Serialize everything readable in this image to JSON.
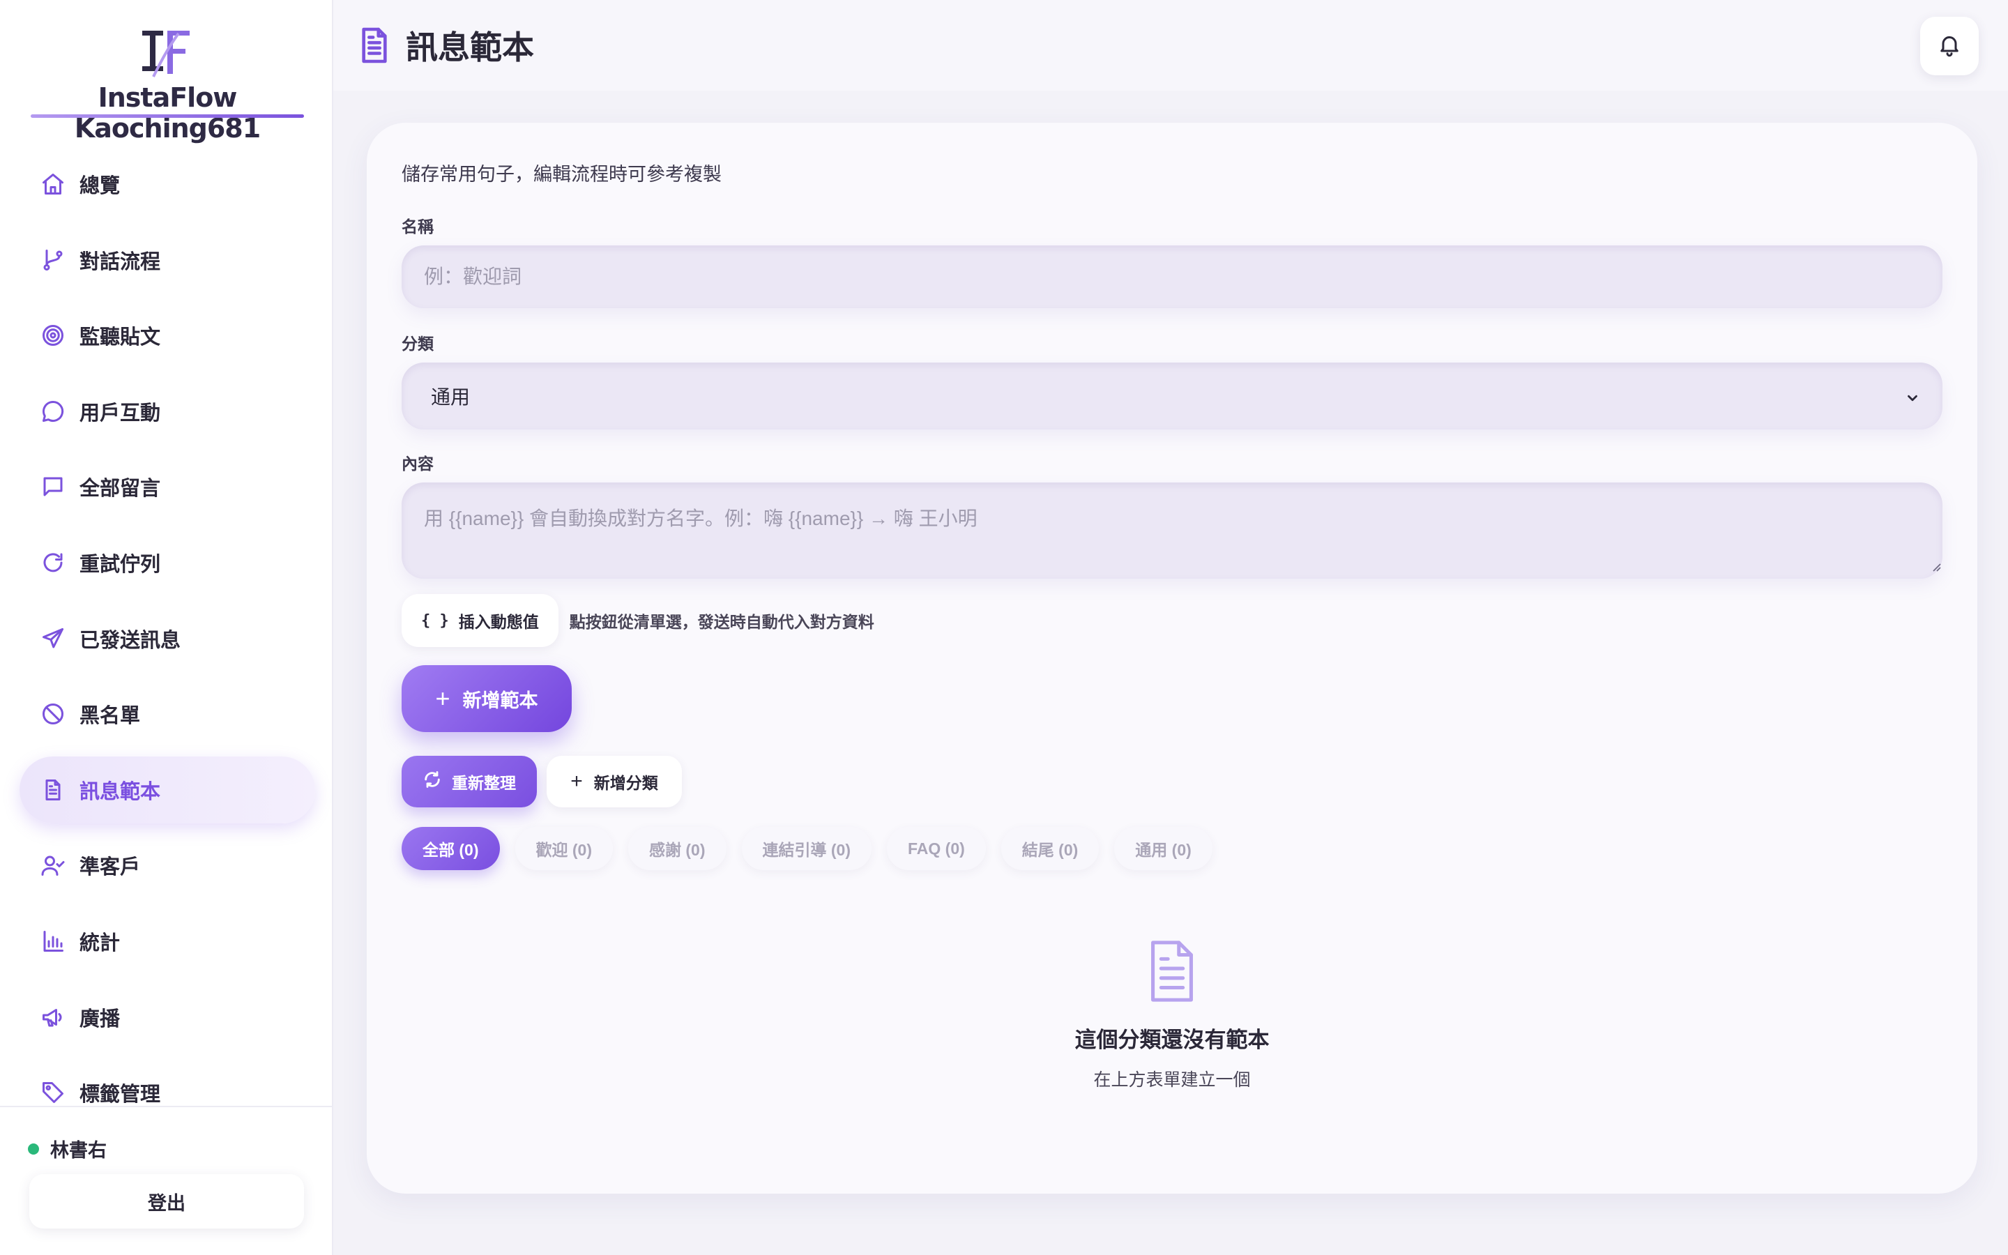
{
  "brand": {
    "name": "InstaFlow Kaoching681",
    "mark": "IF"
  },
  "sidebar": {
    "items": [
      {
        "label": "總覽",
        "icon": "home-icon",
        "active": false
      },
      {
        "label": "對話流程",
        "icon": "git-branch-icon",
        "active": false
      },
      {
        "label": "監聽貼文",
        "icon": "target-icon",
        "active": false
      },
      {
        "label": "用戶互動",
        "icon": "chat-bubble-icon",
        "active": false
      },
      {
        "label": "全部留言",
        "icon": "message-square-icon",
        "active": false
      },
      {
        "label": "重試佇列",
        "icon": "refresh-icon",
        "active": false
      },
      {
        "label": "已發送訊息",
        "icon": "send-icon",
        "active": false
      },
      {
        "label": "黑名單",
        "icon": "ban-icon",
        "active": false
      },
      {
        "label": "訊息範本",
        "icon": "file-text-icon",
        "active": true
      },
      {
        "label": "準客戶",
        "icon": "user-check-icon",
        "active": false
      },
      {
        "label": "統計",
        "icon": "bar-chart-icon",
        "active": false
      },
      {
        "label": "廣播",
        "icon": "megaphone-icon",
        "active": false
      },
      {
        "label": "標籤管理",
        "icon": "tag-icon",
        "active": false
      }
    ],
    "user": {
      "name": "林書右",
      "status_color": "#2ab87a"
    },
    "logout_label": "登出"
  },
  "header": {
    "title": "訊息範本",
    "title_icon": "file-text-icon",
    "bell_icon": "bell-icon"
  },
  "form": {
    "intro": "儲存常用句子，編輯流程時可參考複製",
    "name_label": "名稱",
    "name_placeholder": "例：歡迎詞",
    "name_value": "",
    "category_label": "分類",
    "category_value": "通用",
    "content_label": "內容",
    "content_placeholder": "用 {{name}} 會自動換成對方名字。例：嗨 {{name}} → 嗨 王小明",
    "content_value": "",
    "insert_button": "插入動態值",
    "insert_hint": "點按鈕從清單選，發送時自動代入對方資料",
    "submit_button": "新增範本"
  },
  "toolbar": {
    "refresh_label": "重新整理",
    "add_category_label": "新增分類"
  },
  "filters": [
    {
      "label": "全部 (0)",
      "active": true
    },
    {
      "label": "歡迎 (0)",
      "active": false
    },
    {
      "label": "感謝 (0)",
      "active": false
    },
    {
      "label": "連結引導 (0)",
      "active": false
    },
    {
      "label": "FAQ (0)",
      "active": false
    },
    {
      "label": "結尾 (0)",
      "active": false
    },
    {
      "label": "通用 (0)",
      "active": false
    }
  ],
  "empty_state": {
    "title": "這個分類還沒有範本",
    "subtitle": "在上方表單建立一個",
    "icon": "file-text-icon"
  },
  "colors": {
    "accent": "#7b52dd",
    "accent_light": "#a07cf2",
    "background": "#f3f2f8",
    "online": "#2ab87a"
  }
}
